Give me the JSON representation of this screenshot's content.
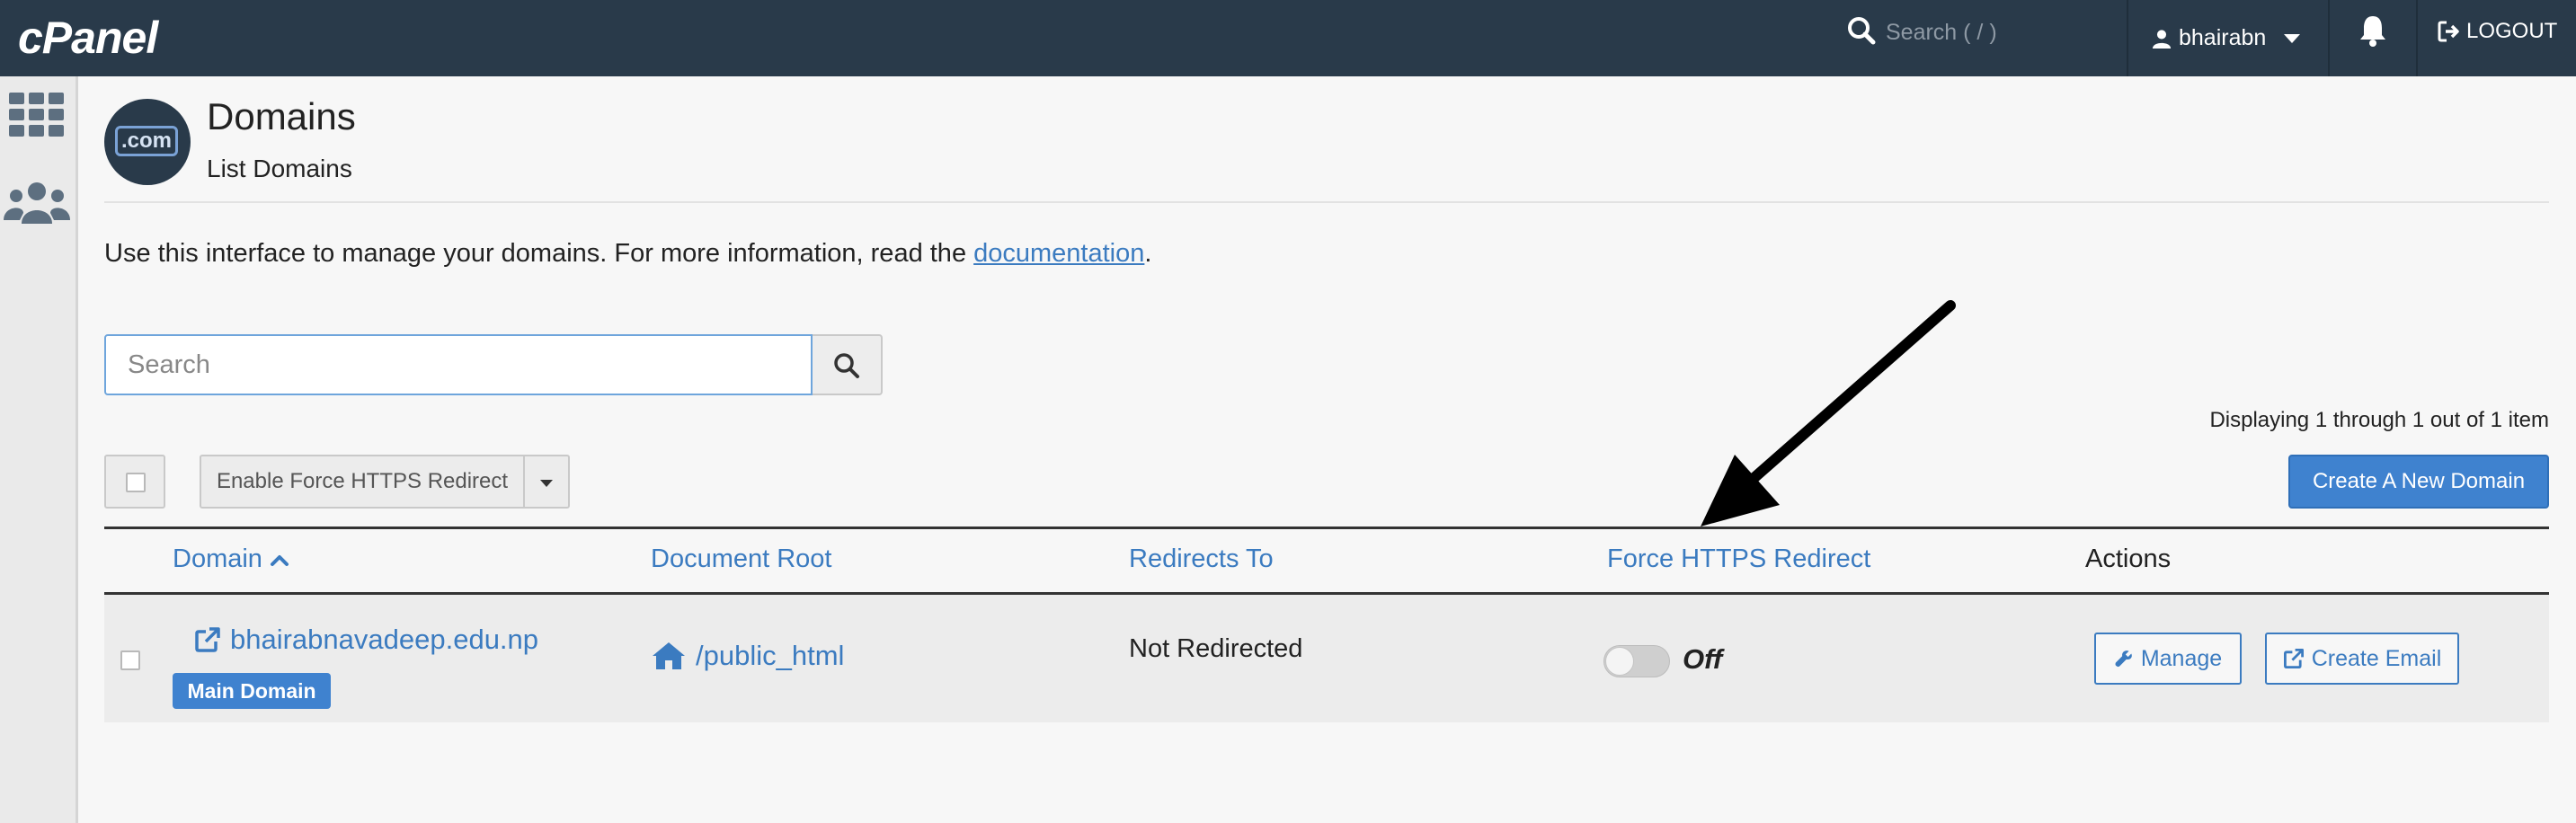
{
  "topbar": {
    "logo": "cPanel",
    "search_placeholder": "Search ( / )",
    "username": "bhairabn",
    "logout_label": "LOGOUT",
    "icons": [
      "search-icon",
      "user-icon",
      "chevron-down-icon",
      "bell-icon",
      "logout-icon"
    ]
  },
  "sidebar": {
    "icons": [
      "apps-grid-icon",
      "users-icon"
    ]
  },
  "header": {
    "icon_text": ".com",
    "title": "Domains",
    "subtitle": "List Domains"
  },
  "intro": {
    "text_before": "Use this interface to manage your domains. For more information, read the ",
    "link_text": "documentation",
    "text_after": "."
  },
  "search": {
    "placeholder": "Search"
  },
  "display_info": "Displaying 1 through 1 out of 1 item",
  "toolbar": {
    "bulk_action_label": "Enable Force HTTPS Redirect",
    "create_label": "Create A New Domain"
  },
  "table": {
    "columns": [
      "Domain",
      "Document Root",
      "Redirects To",
      "Force HTTPS Redirect",
      "Actions"
    ],
    "rows": [
      {
        "domain": "bhairabnavadeep.edu.np",
        "badge": "Main Domain",
        "document_root": "/public_html",
        "redirects_to": "Not Redirected",
        "force_https_state": "Off",
        "actions": [
          "Manage",
          "Create Email"
        ]
      }
    ]
  },
  "colors": {
    "topbar_bg": "#293a4a",
    "link_blue": "#3b7bc0",
    "primary_button": "#3f82cf",
    "row_bg": "#ececec"
  }
}
